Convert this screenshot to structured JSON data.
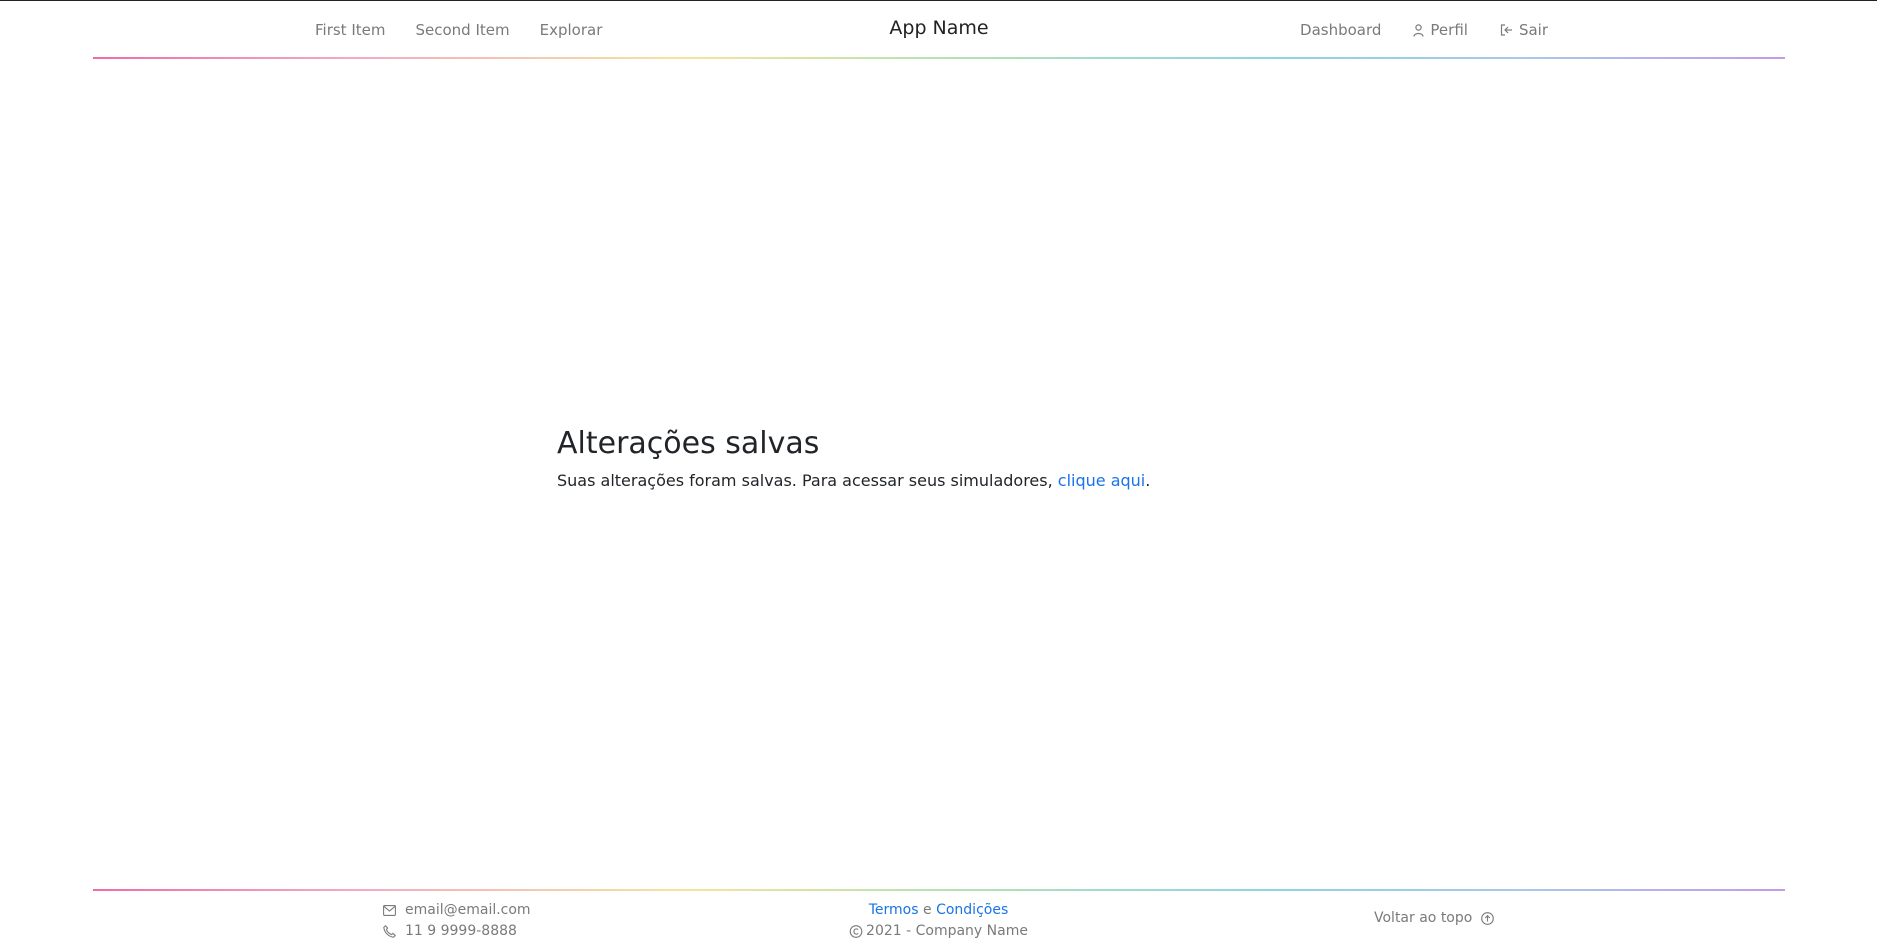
{
  "header": {
    "brand": "App Name",
    "left_nav": [
      "First Item",
      "Second Item",
      "Explorar"
    ],
    "right_nav": {
      "dashboard": "Dashboard",
      "profile": "Perfil",
      "logout": "Sair"
    }
  },
  "main": {
    "title": "Alterações salvas",
    "message": "Suas alterações foram salvas. Para acessar seus simuladores, ",
    "link": "clique aqui",
    "trailing": "."
  },
  "footer": {
    "email": "email@email.com",
    "phone": "11 9 9999-8888",
    "terms": "Termos",
    "and": "e",
    "conditions": "Condições",
    "copyright": "2021 - Company Name",
    "back_to_top": "Voltar ao topo"
  },
  "colors": {
    "link": "#1a73e8",
    "muted": "#7a7a7a",
    "text": "#212529"
  }
}
